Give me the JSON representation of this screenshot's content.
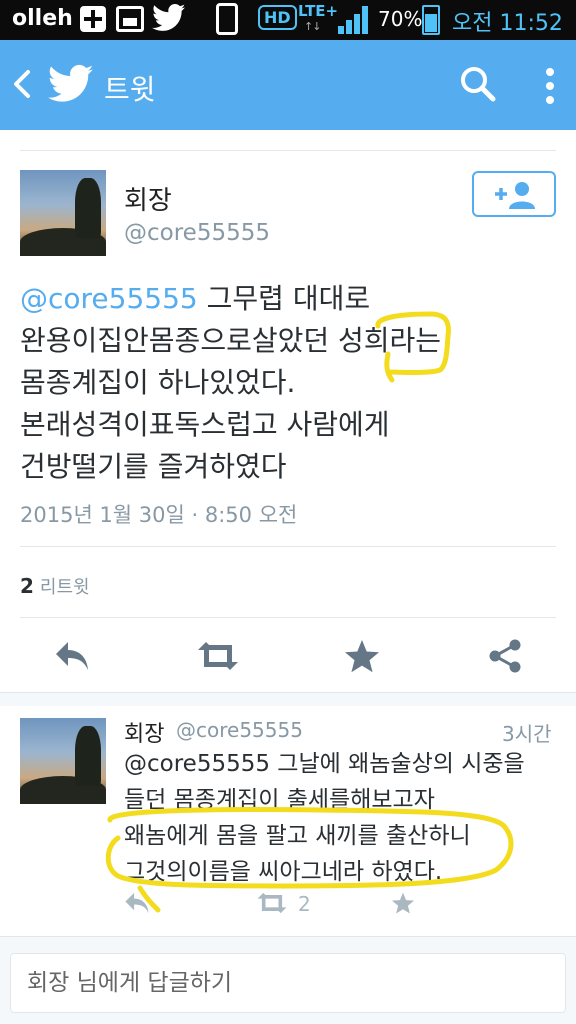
{
  "status_bar": {
    "carrier": "olleh",
    "hd_label": "HD",
    "lte_label": "LTE+",
    "battery": "70%",
    "time": "오전 11:52"
  },
  "app_bar": {
    "title": "트윗",
    "color": "#55acee"
  },
  "tweet": {
    "author_name": "회장",
    "author_handle": "@core55555",
    "mention": "@core55555",
    "text_lines": [
      " 그무렵 대대로",
      "완용이집안몸종으로살았던 성희라는",
      "몸종계집이 하나있었다.",
      "본래성격이표독스럽고 사람에게",
      "건방떨기를 즐겨하였다"
    ],
    "timestamp": "2015년 1월 30일 · 8:50 오전",
    "retweet_count": "2",
    "retweet_label": "리트윗"
  },
  "reply_tweet": {
    "author_name": "회장",
    "author_handle": "@core55555",
    "time_ago": "3시간",
    "text_lines": [
      "@core55555 그날에 왜놈술상의 시중을",
      "들던 몸종계집이 출세를해보고자",
      "왜놈에게 몸을 팔고 새끼를 출산하니",
      "그것의이름을 씨아그네라 하였다."
    ],
    "retweet_count": "2"
  },
  "reply_bar": {
    "placeholder": "회장 님에게 답글하기"
  },
  "colors": {
    "accent": "#55acee",
    "highlight": "#f2dc1d"
  },
  "icons": [
    "back-icon",
    "twitter-bird-icon",
    "search-icon",
    "more-icon",
    "follow-icon",
    "reply-icon",
    "retweet-icon",
    "favorite-icon",
    "share-icon"
  ]
}
